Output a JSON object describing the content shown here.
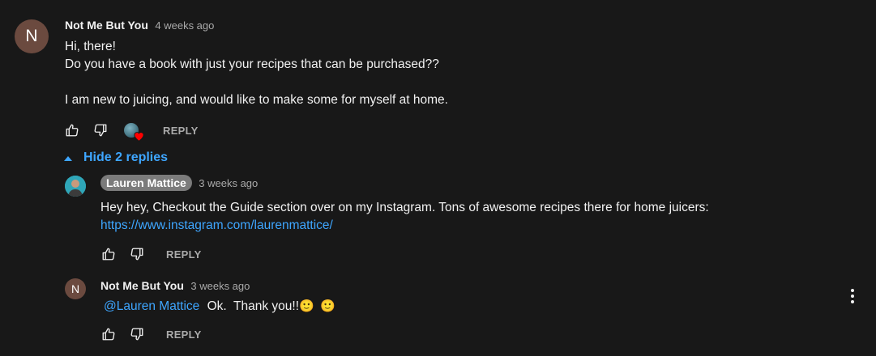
{
  "comment": {
    "avatar_letter": "N",
    "avatar_color": "#6b4a3f",
    "author": "Not Me But You",
    "time": "4 weeks ago",
    "lines": [
      "Hi, there!",
      "Do you have a book with just your recipes that can be purchased??",
      "",
      "I am new to juicing, and would like to make some for myself at home."
    ],
    "reply_label": "REPLY",
    "creator_heart": true
  },
  "replies_toggle": {
    "label": "Hide 2 replies",
    "icon": "caret-up-icon"
  },
  "replies": [
    {
      "author": "Lauren Mattice",
      "time": "3 weeks ago",
      "text": "Hey hey, Checkout the Guide section over on my Instagram. Tons of awesome recipes there for home juicers:",
      "link": "https://www.instagram.com/laurenmattice/",
      "reply_label": "REPLY"
    },
    {
      "avatar_letter": "N",
      "avatar_color": "#6b4a3f",
      "author": "Not Me But You",
      "time": "3 weeks ago",
      "mention": "@Lauren Mattice",
      "text": "Ok.  Thank you!!",
      "emojis": [
        "🙂",
        "🙂"
      ],
      "reply_label": "REPLY"
    }
  ],
  "colors": {
    "background": "#181818",
    "link": "#3ea6ff",
    "secondary": "#aaaaaa",
    "heart": "#ff0000"
  }
}
